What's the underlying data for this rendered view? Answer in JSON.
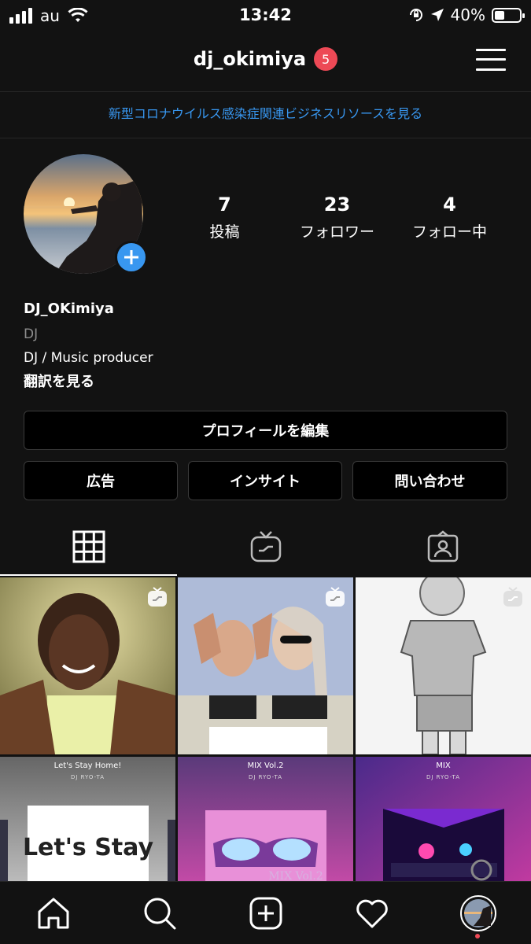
{
  "status_bar": {
    "carrier": "au",
    "time": "13:42",
    "battery_text": "40%",
    "battery_level": 0.4
  },
  "header": {
    "username": "dj_okimiya",
    "notification_count": "5"
  },
  "banner": {
    "text": "新型コロナウイルス感染症関連ビジネスリソースを見る",
    "color": "#3897f0"
  },
  "profile": {
    "stats": [
      {
        "value": "7",
        "label": "投稿"
      },
      {
        "value": "23",
        "label": "フォロワー"
      },
      {
        "value": "4",
        "label": "フォロー中"
      }
    ],
    "name": "DJ_OKimiya",
    "category": "DJ",
    "bio": "DJ / Music producer",
    "translate_label": "翻訳を見る"
  },
  "buttons": {
    "edit_profile": "プロフィールを編集",
    "ads": "広告",
    "insights": "インサイト",
    "contact": "問い合わせ"
  },
  "tabs": [
    {
      "icon": "grid-icon",
      "active": true
    },
    {
      "icon": "igtv-icon",
      "active": false
    },
    {
      "icon": "tagged-icon",
      "active": false
    }
  ],
  "grid": {
    "posts": [
      {
        "type": "igtv",
        "subject": "woman-hand-sign"
      },
      {
        "type": "igtv",
        "subject": "two-women-hand-signs"
      },
      {
        "type": "igtv",
        "subject": "sketch-girl"
      },
      {
        "type": "igtv",
        "title": "Let's Stay Home!",
        "subtitle": "DJ RYO-TA",
        "art_text": "Let's Stay"
      },
      {
        "type": "igtv",
        "title": "MIX Vol.2",
        "subtitle": "DJ RYO-TA",
        "art_text": "MIX Vol.2"
      },
      {
        "type": "igtv",
        "title": "MIX",
        "subtitle": "DJ RYO-TA"
      }
    ]
  },
  "bottom_nav": [
    {
      "icon": "home-icon"
    },
    {
      "icon": "search-icon"
    },
    {
      "icon": "new-post-icon"
    },
    {
      "icon": "activity-heart-icon"
    },
    {
      "icon": "profile-avatar",
      "has_notification_dot": true
    }
  ],
  "colors": {
    "background": "#121212",
    "link_blue": "#3897f0",
    "badge_red": "#ed4956"
  }
}
